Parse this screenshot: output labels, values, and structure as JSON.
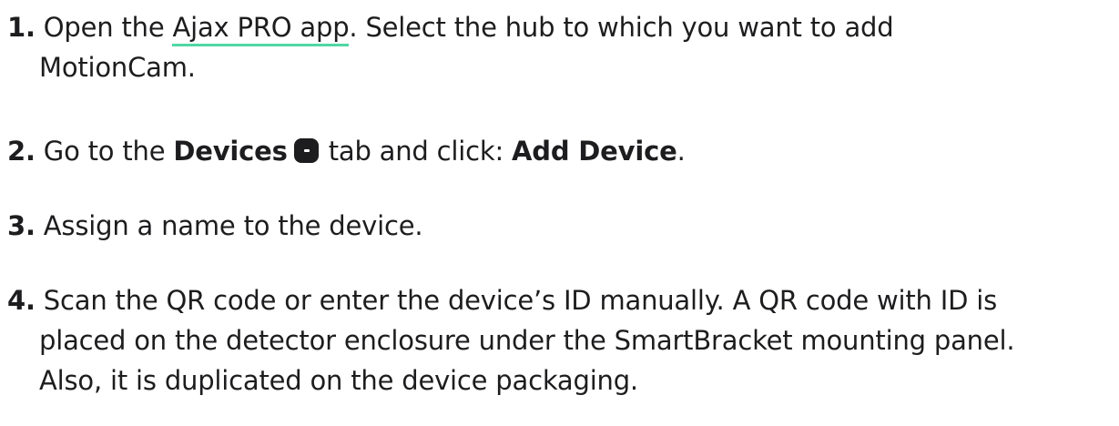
{
  "steps": [
    {
      "number": "1.",
      "line1_before": "Open the ",
      "link_text": "Ajax PRO app",
      "line1_after": ". Select the hub to which you want to add",
      "line2": "MotionCam."
    },
    {
      "number": "2.",
      "text_before": "Go to the ",
      "bold1": "Devices",
      "icon": "devices-tab-icon",
      "text_middle": " tab and click: ",
      "bold2": "Add Device",
      "text_after": "."
    },
    {
      "number": "3.",
      "text": "Assign a name to the device."
    },
    {
      "number": "4.",
      "line1": "Scan the QR code or enter the device’s ID manually. A QR code with ID is",
      "line2": "placed on the detector enclosure under the SmartBracket mounting panel.",
      "line3": "Also, it is duplicated on the device packaging."
    }
  ],
  "colors": {
    "text": "#1d1d1f",
    "link_underline": "#4fd8a5",
    "background": "#ffffff"
  }
}
